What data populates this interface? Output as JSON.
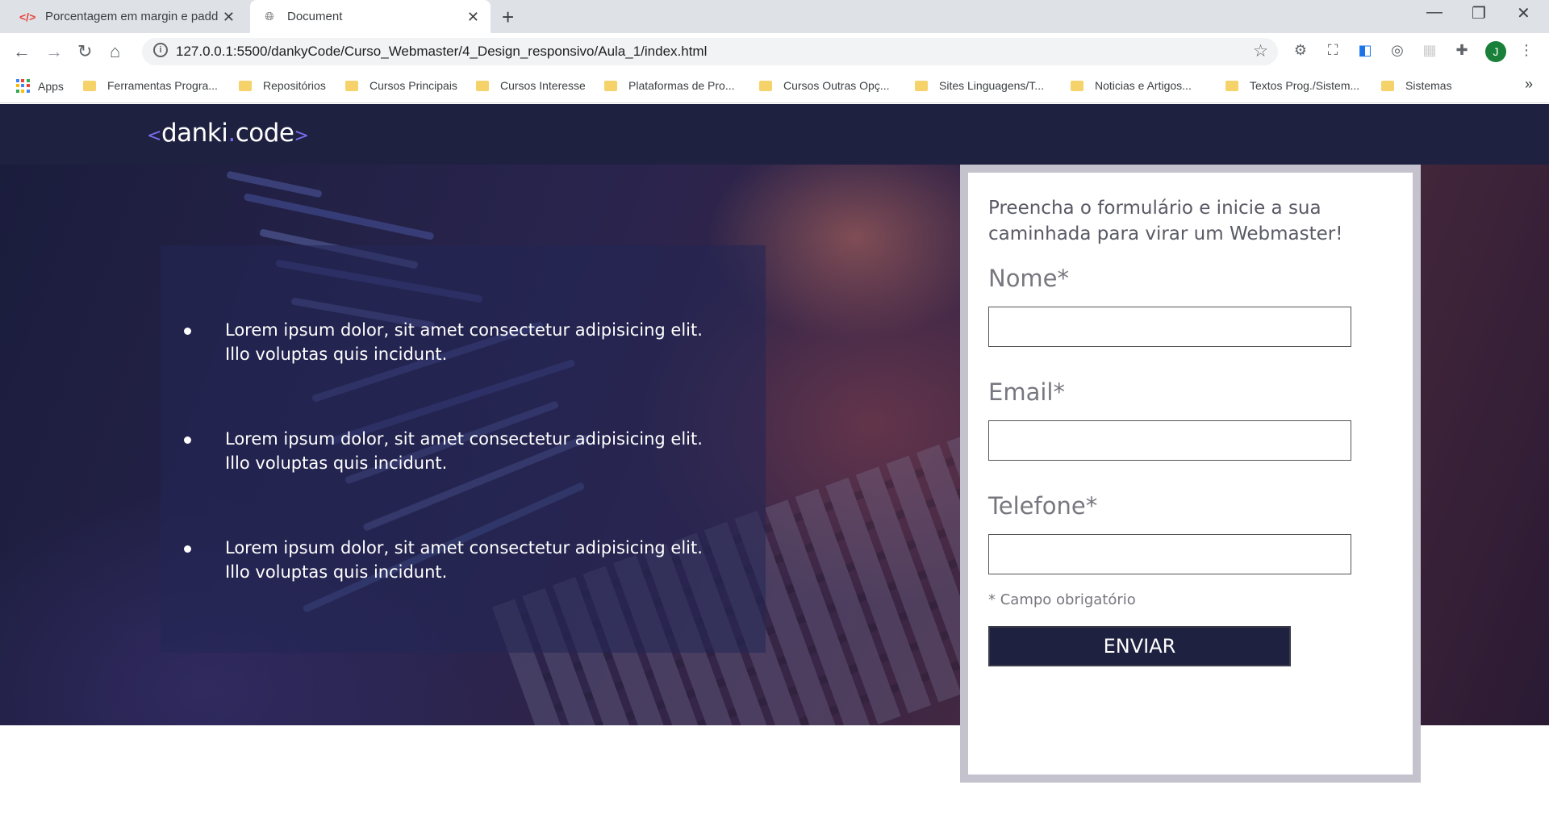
{
  "browser": {
    "tabs": [
      {
        "title": "Porcentagem em margin e padding",
        "icon": "code-icon",
        "active": false
      },
      {
        "title": "Document",
        "icon": "globe-icon",
        "active": true
      }
    ],
    "new_tab": "+",
    "url": "127.0.0.1:5500/dankyCode/Curso_Webmaster/4_Design_responsivo/Aula_1/index.html",
    "avatar_letter": "J",
    "bookmarks": [
      "Apps",
      "Ferramentas Progra...",
      "Repositórios",
      "Cursos Principais",
      "Cursos Interesse",
      "Plataformas de Pro...",
      "Cursos Outras Opç...",
      "Sites Linguagens/T...",
      "Noticias e Artigos...",
      "Textos Prog./Sistem...",
      "Sistemas"
    ],
    "bookmarks_more": "»"
  },
  "site": {
    "logo": {
      "left": "<",
      "name": "danki",
      "dot": ".",
      "suffix": "code",
      "right": ">"
    },
    "benefits": [
      "Lorem ipsum dolor, sit amet consectetur adipisicing elit. Illo voluptas quis incidunt.",
      "Lorem ipsum dolor, sit amet consectetur adipisicing elit. Illo voluptas quis incidunt.",
      "Lorem ipsum dolor, sit amet consectetur adipisicing elit. Illo voluptas quis incidunt."
    ],
    "form": {
      "title": "Preencha o formulário e inicie a sua caminhada para virar um Webmaster!",
      "name_label": "Nome*",
      "email_label": "Email*",
      "phone_label": "Telefone*",
      "required_note": "* Campo obrigatório",
      "submit_label": "ENVIAR"
    }
  },
  "colors": {
    "header_bg": "#1f2141",
    "accent": "#7c6df0",
    "form_border": "#c3c2cd"
  }
}
